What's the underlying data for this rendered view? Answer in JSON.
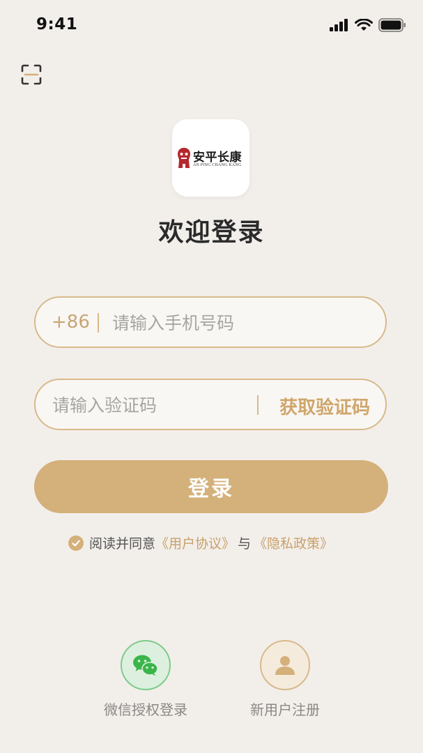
{
  "status_bar": {
    "time": "9:41",
    "icons": [
      "signal-icon",
      "wifi-icon",
      "battery-icon"
    ]
  },
  "header": {
    "scan_icon": "scan-icon"
  },
  "logo": {
    "cn_name": "安平长康",
    "en_name": "AN PING CHANG KANG"
  },
  "title": "欢迎登录",
  "phone_field": {
    "prefix": "+86",
    "placeholder": "请输入手机号码",
    "value": ""
  },
  "code_field": {
    "placeholder": "请输入验证码",
    "value": "",
    "get_code_label": "获取验证码"
  },
  "login_button": {
    "label": "登录"
  },
  "agreement": {
    "checked": true,
    "text": "阅读并同意",
    "user_agreement": "《用户协议》",
    "join": "与",
    "privacy_policy": "《隐私政策》"
  },
  "bottom_actions": {
    "wechat_label": "微信授权登录",
    "register_label": "新用户注册"
  },
  "colors": {
    "background": "#f2efeb",
    "accent": "#d4b07a",
    "accent_text": "#c8a06a",
    "border": "#d8b98a",
    "wechat_green": "#3ab54a"
  }
}
